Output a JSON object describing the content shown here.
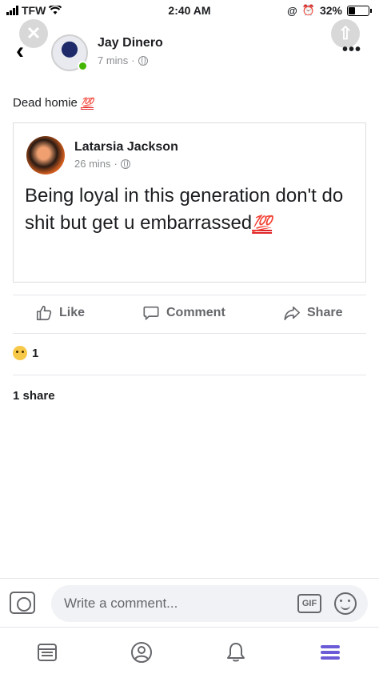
{
  "status_bar": {
    "carrier": "TFW",
    "time": "2:40 AM",
    "battery": "32%",
    "battery_level": 0.32
  },
  "post": {
    "author": "Jay Dinero",
    "time_ago": "7 mins",
    "text": "Dead homie",
    "emoji": "💯"
  },
  "shared_post": {
    "author": "Latarsia Jackson",
    "time_ago": "26 mins",
    "text": "Being loyal in this generation don't do shit but get u embarrassed",
    "emoji": "💯"
  },
  "actions": {
    "like": "Like",
    "comment": "Comment",
    "share": "Share"
  },
  "reactions": {
    "count": "1"
  },
  "shares": {
    "label": "1 share"
  },
  "comment_bar": {
    "placeholder": "Write a comment...",
    "gif_label": "GIF"
  },
  "icons": [
    "close-icon",
    "upload-icon",
    "back-icon",
    "globe-icon",
    "more-icon",
    "like-icon",
    "comment-icon",
    "share-icon",
    "sad-reaction-icon",
    "camera-icon",
    "gif-icon",
    "emoji-icon",
    "news-feed-icon",
    "profile-icon",
    "notifications-icon",
    "menu-icon"
  ],
  "colors": {
    "accent": "#6b5bd6",
    "online": "#44b700",
    "hundred": "#e0262b",
    "muted": "#65676b"
  }
}
